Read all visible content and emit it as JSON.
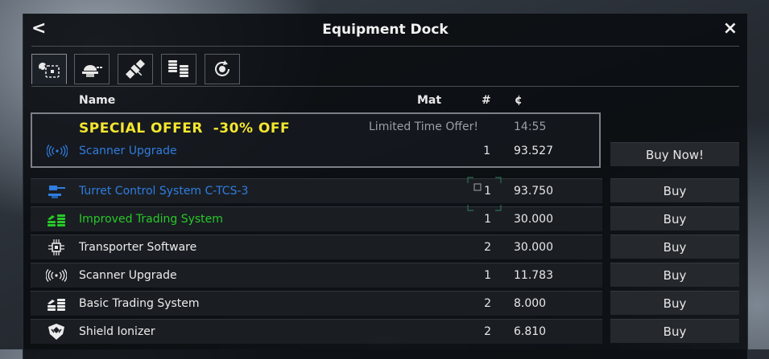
{
  "window": {
    "title": "Equipment Dock",
    "back_label": "<",
    "close_label": "×"
  },
  "tabs": [
    {
      "icon": "equipment-icon",
      "active": true
    },
    {
      "icon": "turret-icon",
      "active": false
    },
    {
      "icon": "satellite-icon",
      "active": false
    },
    {
      "icon": "credits-stack-icon",
      "active": false
    },
    {
      "icon": "refresh-icon",
      "active": false
    }
  ],
  "columns": {
    "name": "Name",
    "mat": "Mat",
    "qty": "#",
    "price": "¢"
  },
  "special_offer": {
    "headline": "SPECIAL OFFER  -30% OFF",
    "limited": "Limited Time Offer!",
    "timer": "14:55",
    "item": {
      "name": "Scanner Upgrade",
      "qty": "1",
      "price": "93.527",
      "icon": "scanner-icon"
    },
    "button_label": "Buy Now!"
  },
  "items": [
    {
      "name": "Turret Control System C-TCS-3",
      "qty": "1",
      "price": "93.750",
      "color": "#2f7de0",
      "icon": "turret-control-icon"
    },
    {
      "name": "Improved Trading System",
      "qty": "1",
      "price": "30.000",
      "color": "#28c828",
      "icon": "trading-system-green-icon"
    },
    {
      "name": "Transporter Software",
      "qty": "2",
      "price": "30.000",
      "color": "#ececec",
      "icon": "transporter-chip-icon"
    },
    {
      "name": "Scanner Upgrade",
      "qty": "1",
      "price": "11.783",
      "color": "#ececec",
      "icon": "scanner-icon"
    },
    {
      "name": "Basic Trading System",
      "qty": "2",
      "price": "8.000",
      "color": "#ececec",
      "icon": "trading-system-icon"
    },
    {
      "name": "Shield Ionizer",
      "qty": "2",
      "price": "6.810",
      "color": "#ececec",
      "icon": "shield-icon"
    }
  ],
  "buy_label": "Buy",
  "colors": {
    "offer_yellow": "#f4e62e",
    "rare_blue": "#2f7de0",
    "uncommon_green": "#28c828"
  }
}
